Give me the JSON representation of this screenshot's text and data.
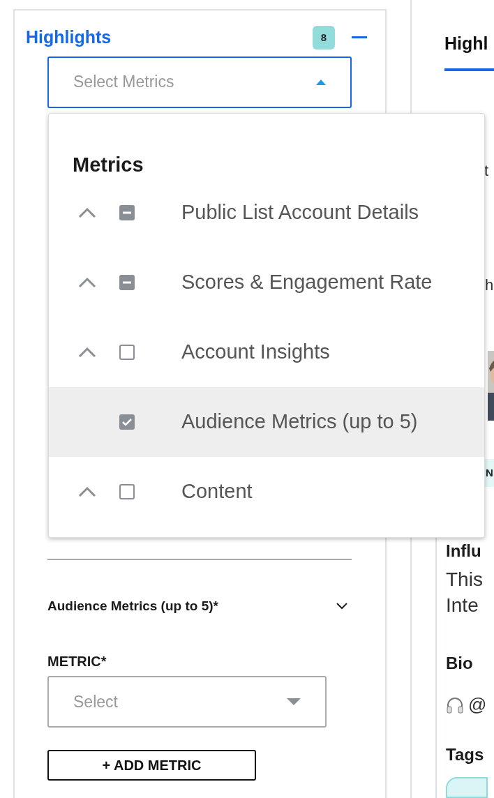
{
  "panel": {
    "title": "Highlights",
    "count": "8",
    "collapsed": false
  },
  "metrics_select": {
    "placeholder": "Select Metrics",
    "expanded": true
  },
  "dropdown": {
    "heading": "Metrics",
    "items": [
      {
        "label": "Public List Account Details",
        "expandable": true,
        "checked": false,
        "partial": true,
        "selected": false
      },
      {
        "label": "Scores & Engagement Rate",
        "expandable": true,
        "checked": false,
        "partial": true,
        "selected": false
      },
      {
        "label": "Account Insights",
        "expandable": true,
        "checked": false,
        "partial": false,
        "selected": false
      },
      {
        "label": "Audience Metrics (up to 5)",
        "expandable": false,
        "checked": true,
        "partial": false,
        "selected": true
      },
      {
        "label": "Content",
        "expandable": true,
        "checked": false,
        "partial": false,
        "selected": false
      }
    ]
  },
  "section": {
    "title": "Audience Metrics (up to 5)*",
    "expanded": false
  },
  "metric_field": {
    "label": "METRIC*",
    "placeholder": "Select"
  },
  "add_button": "+ ADD METRIC",
  "right_panel": {
    "tabs": [
      {
        "label": "Highl",
        "selected": true
      }
    ],
    "texts": [
      {
        "kind": "line",
        "text": "t"
      },
      {
        "kind": "heading",
        "text": "h"
      },
      {
        "kind": "picture"
      },
      {
        "kind": "tag",
        "text": "N"
      },
      {
        "kind": "subheading",
        "text": "Influ"
      },
      {
        "kind": "para",
        "text": "This"
      },
      {
        "kind": "para",
        "text": "Inte"
      },
      {
        "kind": "subheading",
        "text": "Bio"
      },
      {
        "kind": "bio",
        "text": "@"
      },
      {
        "kind": "subheading",
        "text": "Tags"
      },
      {
        "kind": "chip"
      }
    ]
  }
}
